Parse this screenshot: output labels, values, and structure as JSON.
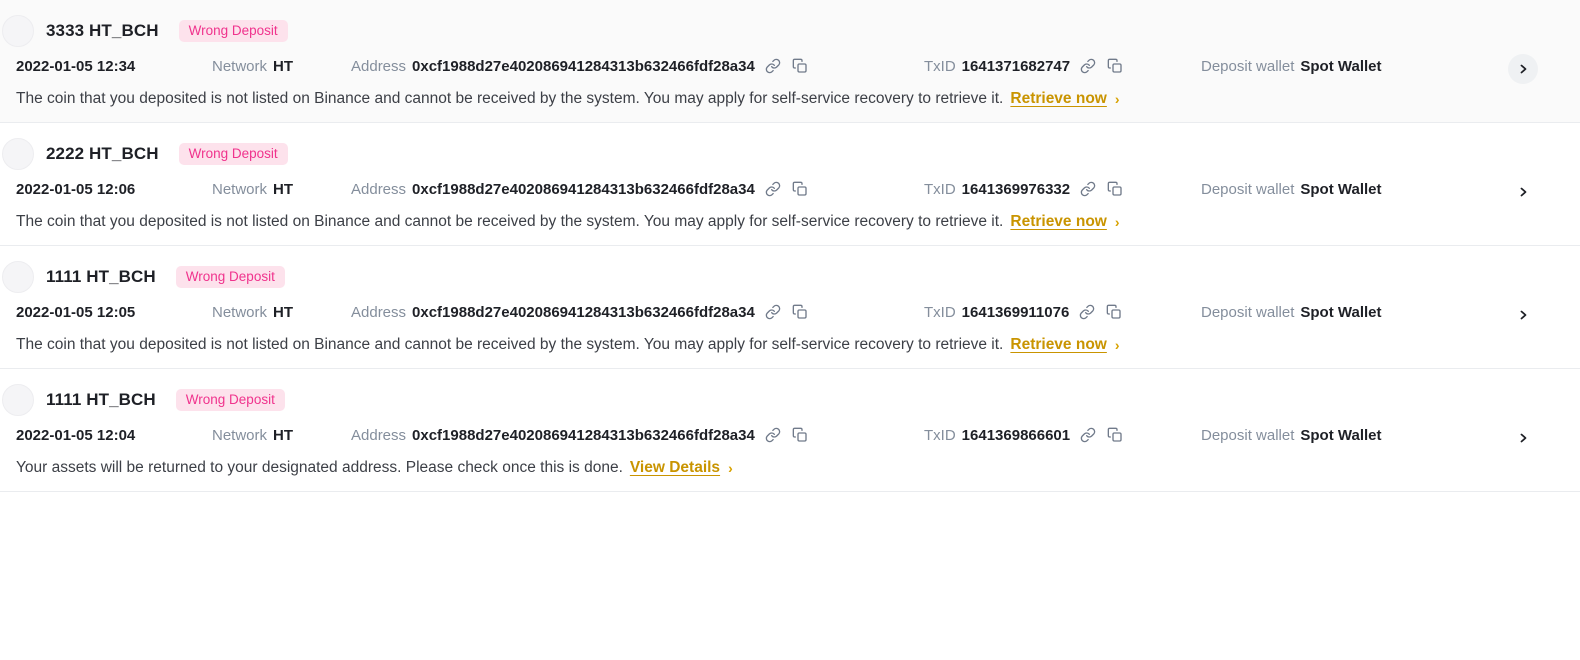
{
  "labels": {
    "network": "Network",
    "address": "Address",
    "txid": "TxID",
    "deposit_wallet": "Deposit wallet"
  },
  "colors": {
    "badge_bg": "#fde2ec",
    "badge_text": "#f0338d",
    "link": "#c99400",
    "label_text": "#848e9c",
    "value_text": "#1e2026",
    "row_hover_bg": "#fafafa",
    "divider": "#eaecef"
  },
  "icons": {
    "link": "link-icon",
    "copy": "copy-icon",
    "chevron": "chevron-right-icon"
  },
  "deposits": [
    {
      "amount": "3333 HT_BCH",
      "status": "Wrong Deposit",
      "time": "2022-01-05 12:34",
      "network": "HT",
      "address": "0xcf1988d27e402086941284313b632466fdf28a34",
      "txid": "1641371682747",
      "wallet": "Spot Wallet",
      "message": "The coin that you deposited is not listed on Binance and cannot be received by the system. You may apply for self-service recovery to retrieve it.",
      "link": "Retrieve now",
      "hovered": true
    },
    {
      "amount": "2222 HT_BCH",
      "status": "Wrong Deposit",
      "time": "2022-01-05 12:06",
      "network": "HT",
      "address": "0xcf1988d27e402086941284313b632466fdf28a34",
      "txid": "1641369976332",
      "wallet": "Spot Wallet",
      "message": "The coin that you deposited is not listed on Binance and cannot be received by the system. You may apply for self-service recovery to retrieve it.",
      "link": "Retrieve now",
      "hovered": false
    },
    {
      "amount": "1111 HT_BCH",
      "status": "Wrong Deposit",
      "time": "2022-01-05 12:05",
      "network": "HT",
      "address": "0xcf1988d27e402086941284313b632466fdf28a34",
      "txid": "1641369911076",
      "wallet": "Spot Wallet",
      "message": "The coin that you deposited is not listed on Binance and cannot be received by the system. You may apply for self-service recovery to retrieve it.",
      "link": "Retrieve now",
      "hovered": false
    },
    {
      "amount": "1111 HT_BCH",
      "status": "Wrong Deposit",
      "time": "2022-01-05 12:04",
      "network": "HT",
      "address": "0xcf1988d27e402086941284313b632466fdf28a34",
      "txid": "1641369866601",
      "wallet": "Spot Wallet",
      "message": "Your assets will be returned to your designated address. Please check once this is done.",
      "link": "View Details",
      "hovered": false
    }
  ]
}
